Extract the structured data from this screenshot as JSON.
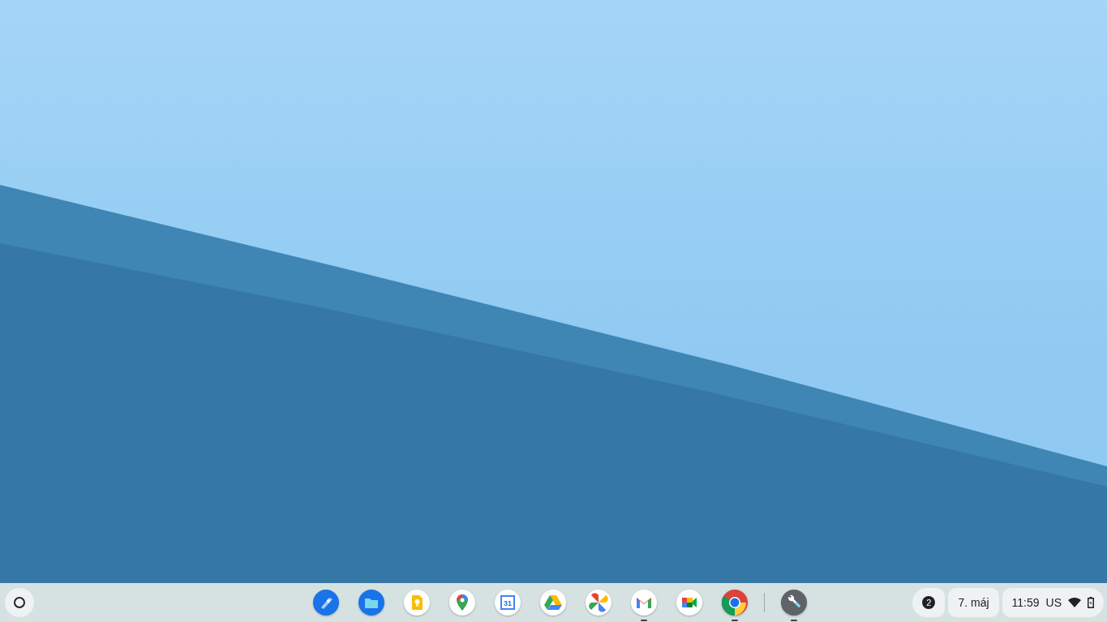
{
  "shelf": {
    "apps": [
      {
        "kind": "explore",
        "running": false
      },
      {
        "kind": "files",
        "running": false
      },
      {
        "kind": "keep",
        "running": false
      },
      {
        "kind": "maps",
        "running": false
      },
      {
        "kind": "calendar",
        "running": false,
        "label": "31"
      },
      {
        "kind": "drive",
        "running": false
      },
      {
        "kind": "photos",
        "running": false
      },
      {
        "kind": "gmail",
        "running": true
      },
      {
        "kind": "meet",
        "running": false
      },
      {
        "kind": "chrome",
        "running": true
      }
    ],
    "pinned_after_divider": [
      {
        "kind": "wrench",
        "running": true
      }
    ],
    "notification_count": "2",
    "date": "7. máj",
    "time": "11:59",
    "keyboard_layout": "US"
  }
}
